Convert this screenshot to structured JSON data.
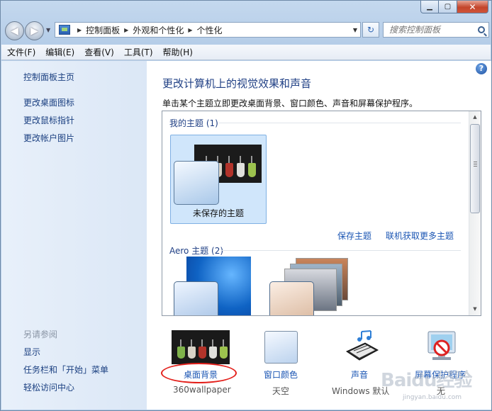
{
  "address": {
    "crumbs": [
      "控制面板",
      "外观和个性化",
      "个性化"
    ]
  },
  "search": {
    "placeholder": "搜索控制面板"
  },
  "menu": [
    "文件(F)",
    "编辑(E)",
    "查看(V)",
    "工具(T)",
    "帮助(H)"
  ],
  "sidebar": {
    "home": "控制面板主页",
    "links": [
      "更改桌面图标",
      "更改鼠标指针",
      "更改帐户图片"
    ],
    "see_also": "另请参阅",
    "see_also_links": [
      "显示",
      "任务栏和「开始」菜单",
      "轻松访问中心"
    ]
  },
  "main": {
    "title": "更改计算机上的视觉效果和声音",
    "subtitle": "单击某个主题立即更改桌面背景、窗口颜色、声音和屏幕保护程序。",
    "my_themes_label": "我的主题 (1)",
    "unsaved_theme": "未保存的主题",
    "save_theme": "保存主题",
    "get_more": "联机获取更多主题",
    "aero_label": "Aero 主题 (2)"
  },
  "settings": {
    "background": {
      "label": "桌面背景",
      "value": "360wallpaper"
    },
    "color": {
      "label": "窗口颜色",
      "value": "天空"
    },
    "sound": {
      "label": "声音",
      "value": "Windows 默认"
    },
    "saver": {
      "label": "屏幕保护程序",
      "value": "无"
    }
  },
  "watermark": {
    "text": "Baidu经验",
    "sub": "jingyan.baidu.com"
  },
  "colors": {
    "link": "#1a55b3",
    "title": "#1f3f84",
    "annotation_ring": "#e3201b"
  }
}
